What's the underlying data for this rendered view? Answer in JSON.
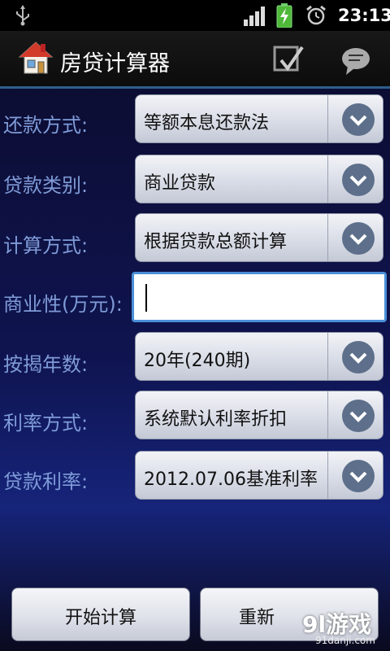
{
  "status_bar": {
    "time": "23:13",
    "icons": [
      "usb-icon",
      "signal-icon",
      "battery-charging-icon",
      "alarm-icon"
    ]
  },
  "app": {
    "title": "房贷计算器",
    "icons": [
      "house-icon",
      "check-icon",
      "chat-icon"
    ]
  },
  "form": {
    "repayment_method": {
      "label": "还款方式:",
      "value": "等额本息还款法"
    },
    "loan_type": {
      "label": "贷款类别:",
      "value": "商业贷款"
    },
    "calc_method": {
      "label": "计算方式:",
      "value": "根据贷款总额计算"
    },
    "commercial_amount": {
      "label": "商业性(万元):",
      "value": "",
      "placeholder": ""
    },
    "mortgage_years": {
      "label": "按揭年数:",
      "value": "20年(240期)"
    },
    "rate_method": {
      "label": "利率方式:",
      "value": "系统默认利率折扣"
    },
    "loan_rate": {
      "label": "贷款利率:",
      "value": "2012.07.06基准利率"
    }
  },
  "buttons": {
    "calculate": "开始计算",
    "reset": "重新"
  },
  "watermark": {
    "main": "9l游戏",
    "sub": "91danji.com"
  },
  "colors": {
    "label": "#7f9bd8",
    "accent": "#2f5d8c",
    "focus_border": "#4a8fd8"
  }
}
